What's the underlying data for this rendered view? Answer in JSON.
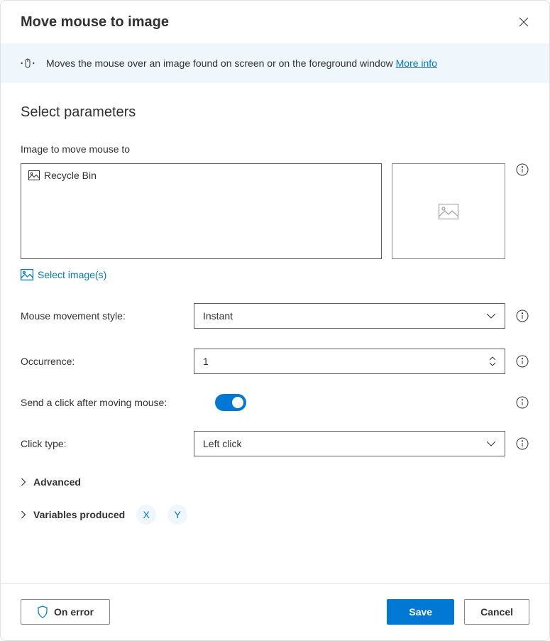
{
  "header": {
    "title": "Move mouse to image"
  },
  "infoBar": {
    "text": "Moves the mouse over an image found on screen or on the foreground window ",
    "linkText": "More info"
  },
  "section": {
    "title": "Select parameters"
  },
  "imageField": {
    "label": "Image to move mouse to",
    "selectedImage": "Recycle Bin",
    "selectLink": "Select image(s)"
  },
  "params": {
    "movementStyle": {
      "label": "Mouse movement style:",
      "value": "Instant"
    },
    "occurrence": {
      "label": "Occurrence:",
      "value": "1"
    },
    "sendClick": {
      "label": "Send a click after moving mouse:"
    },
    "clickType": {
      "label": "Click type:",
      "value": "Left click"
    }
  },
  "expanders": {
    "advanced": "Advanced",
    "variables": "Variables produced",
    "var1": "X",
    "var2": "Y"
  },
  "footer": {
    "onError": "On error",
    "save": "Save",
    "cancel": "Cancel"
  }
}
